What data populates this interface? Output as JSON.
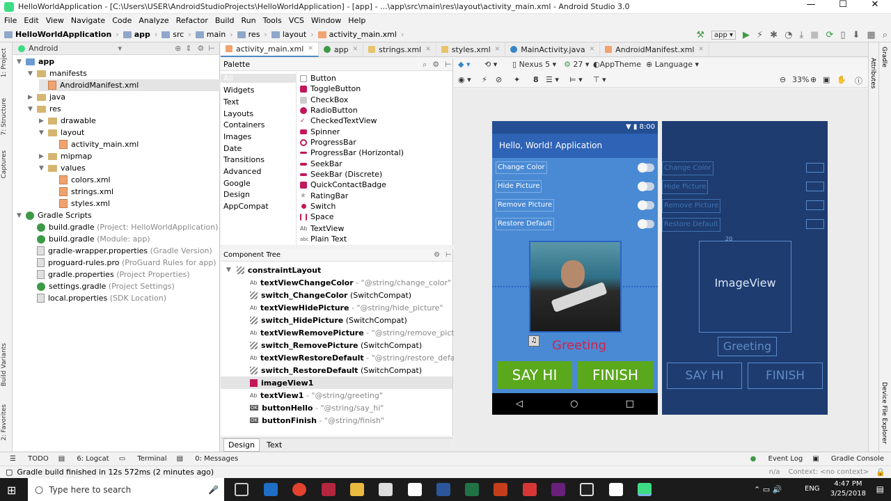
{
  "window": {
    "title": "HelloWorldApplication - [C:\\Users\\USER\\AndroidStudioProjects\\HelloWorldApplication] - [app] - ...\\app\\src\\main\\res\\layout\\activity_main.xml - Android Studio 3.0",
    "minimize": "—",
    "maximize": "☐",
    "close": "✕"
  },
  "menu": [
    "File",
    "Edit",
    "View",
    "Navigate",
    "Code",
    "Analyze",
    "Refactor",
    "Build",
    "Run",
    "Tools",
    "VCS",
    "Window",
    "Help"
  ],
  "breadcrumb": [
    "HelloWorldApplication",
    "app",
    "src",
    "main",
    "res",
    "layout",
    "activity_main.xml"
  ],
  "toolbar": {
    "run_config": "app ▾"
  },
  "left_strip": {
    "project": "1: Project",
    "structure": "7: Structure",
    "captures": "Captures",
    "build_variants": "Build Variants",
    "favorites": "2: Favorites"
  },
  "project": {
    "view_select": "Android",
    "tree": [
      {
        "label": "app",
        "note": "",
        "bold": true
      },
      {
        "label": "manifests",
        "note": ""
      },
      {
        "label": "AndroidManifest.xml",
        "note": ""
      },
      {
        "label": "java",
        "note": ""
      },
      {
        "label": "res",
        "note": ""
      },
      {
        "label": "drawable",
        "note": ""
      },
      {
        "label": "layout",
        "note": ""
      },
      {
        "label": "activity_main.xml",
        "note": ""
      },
      {
        "label": "mipmap",
        "note": ""
      },
      {
        "label": "values",
        "note": ""
      },
      {
        "label": "colors.xml",
        "note": ""
      },
      {
        "label": "strings.xml",
        "note": ""
      },
      {
        "label": "styles.xml",
        "note": ""
      },
      {
        "label": "Gradle Scripts",
        "note": ""
      },
      {
        "label": "build.gradle",
        "note": "(Project: HelloWorldApplication)"
      },
      {
        "label": "build.gradle",
        "note": "(Module: app)"
      },
      {
        "label": "gradle-wrapper.properties",
        "note": "(Gradle Version)"
      },
      {
        "label": "proguard-rules.pro",
        "note": "(ProGuard Rules for app)"
      },
      {
        "label": "gradle.properties",
        "note": "(Project Properties)"
      },
      {
        "label": "settings.gradle",
        "note": "(Project Settings)"
      },
      {
        "label": "local.properties",
        "note": "(SDK Location)"
      }
    ]
  },
  "editor_tabs": [
    "activity_main.xml",
    "app",
    "strings.xml",
    "styles.xml",
    "MainActivity.java",
    "AndroidManifest.xml"
  ],
  "palette": {
    "title": "Palette",
    "categories": [
      "All",
      "Widgets",
      "Text",
      "Layouts",
      "Containers",
      "Images",
      "Date",
      "Transitions",
      "Advanced",
      "Google",
      "Design",
      "AppCompat"
    ],
    "widgets": [
      "Button",
      "ToggleButton",
      "CheckBox",
      "RadioButton",
      "CheckedTextView",
      "Spinner",
      "ProgressBar",
      "ProgressBar (Horizontal)",
      "SeekBar",
      "SeekBar (Discrete)",
      "QuickContactBadge",
      "RatingBar",
      "Switch",
      "Space",
      "TextView",
      "Plain Text"
    ]
  },
  "component_tree": {
    "title": "Component Tree",
    "items": [
      {
        "kind": "layout",
        "name": "constraintLayout",
        "note": ""
      },
      {
        "kind": "text",
        "name": "textViewChangeColor",
        "note": "- \"@string/change_color\""
      },
      {
        "kind": "switch",
        "name": "switch_ChangeColor",
        "note": "(SwitchCompat)"
      },
      {
        "kind": "text",
        "name": "textViewHidePicture",
        "note": "- \"@string/hide_picture\""
      },
      {
        "kind": "switch",
        "name": "switch_HidePicture",
        "note": "(SwitchCompat)"
      },
      {
        "kind": "text",
        "name": "textViewRemovePicture",
        "note": "- \"@string/remove_picture\""
      },
      {
        "kind": "switch",
        "name": "switch_RemovePicture",
        "note": "(SwitchCompat)"
      },
      {
        "kind": "text",
        "name": "textViewRestoreDefault",
        "note": "- \"@string/restore_default\""
      },
      {
        "kind": "switch",
        "name": "switch_RestoreDefault",
        "note": "(SwitchCompat)"
      },
      {
        "kind": "image",
        "name": "imageView1",
        "note": ""
      },
      {
        "kind": "text",
        "name": "textView1",
        "note": "- \"@string/greeting\""
      },
      {
        "kind": "button",
        "name": "buttonHello",
        "note": "- \"@string/say_hi\""
      },
      {
        "kind": "button",
        "name": "buttonFinish",
        "note": "- \"@string/finish\""
      }
    ]
  },
  "design_tabs": [
    "Design",
    "Text"
  ],
  "design_toolbar": {
    "device": "Nexus 5 ▾",
    "api": "27 ▾",
    "theme": "AppTheme",
    "language": "Language ▾",
    "zoom": "33%",
    "margin": "8"
  },
  "phone": {
    "time": "8:00",
    "app_title": "Hello, World! Application",
    "labels": [
      "Change Color",
      "Hide Picture",
      "Remove Picture",
      "Restore Default"
    ],
    "greeting": "Greeting",
    "say_hi": "SAY HI",
    "finish": "FINISH",
    "nav": [
      "◁",
      "○",
      "□"
    ]
  },
  "blueprint": {
    "image_label": "ImageView",
    "greeting": "Greeting",
    "say_hi": "SAY HI",
    "finish": "FINISH",
    "margin": "20"
  },
  "right_strip": {
    "gradle": "Gradle",
    "attributes": "Attributes",
    "device_explorer": "Device File Explorer"
  },
  "bottom_tools": {
    "todo": "TODO",
    "logcat": "6: Logcat",
    "terminal": "Terminal",
    "messages": "0: Messages",
    "event_log": "Event Log",
    "gradle_console": "Gradle Console"
  },
  "status": {
    "message": "Gradle build finished in 12s 572ms (2 minutes ago)",
    "na": "n/a",
    "context": "Context: <no context>"
  },
  "taskbar": {
    "search": "Type here to search",
    "lang": "ENG",
    "time": "4:47 PM",
    "date": "3/25/2018"
  }
}
